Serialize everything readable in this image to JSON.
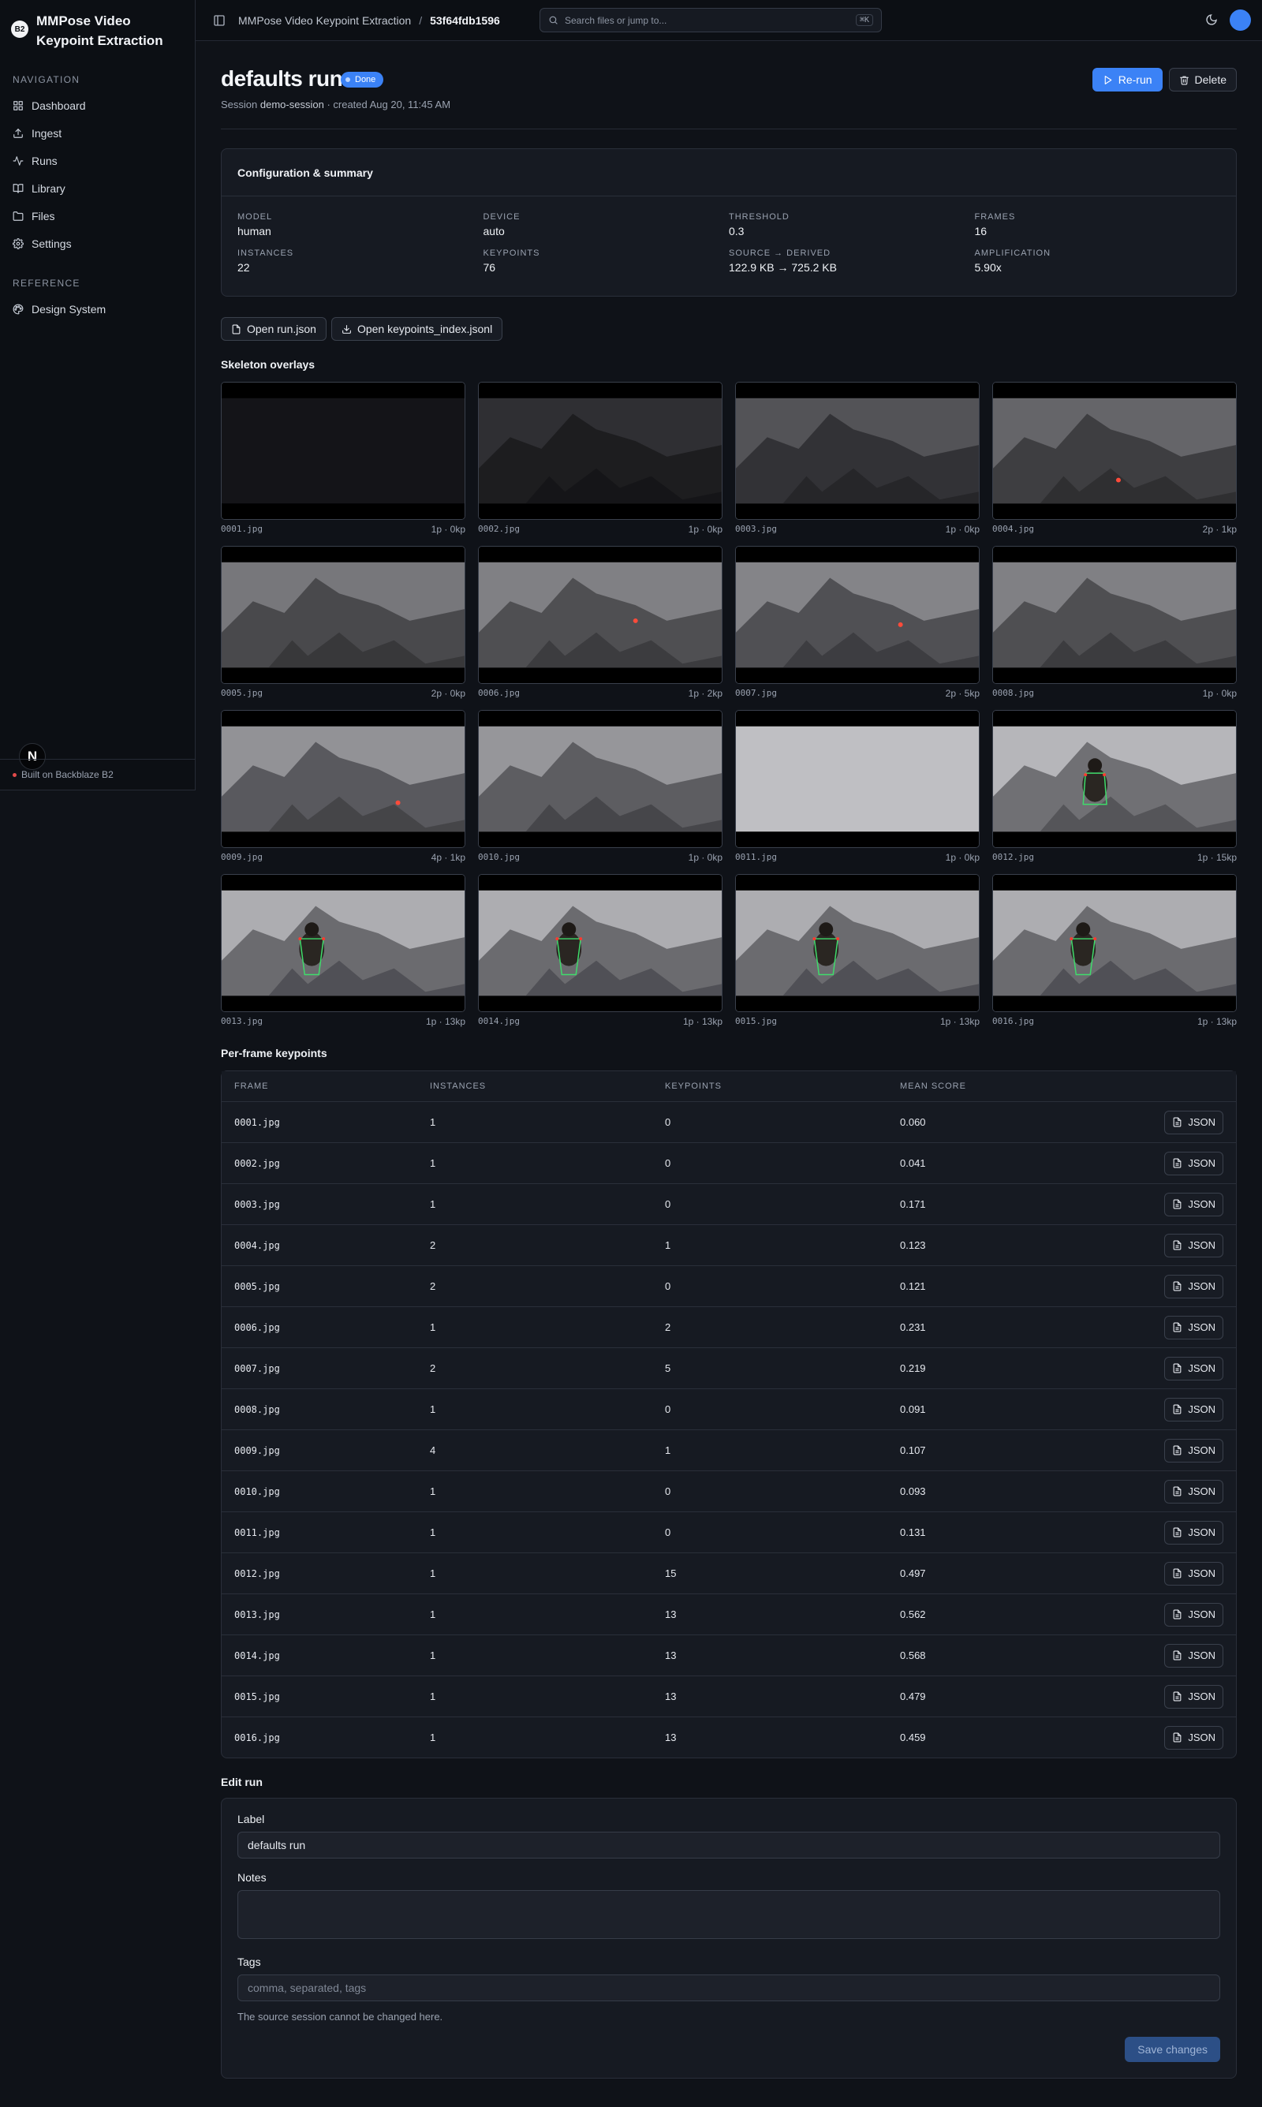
{
  "app": {
    "logo": "B2",
    "title": "MMPose Video Keypoint Extraction"
  },
  "sidebar": {
    "nav_heading": "NAVIGATION",
    "nav": [
      {
        "label": "Dashboard",
        "icon": "grid-icon"
      },
      {
        "label": "Ingest",
        "icon": "upload-icon"
      },
      {
        "label": "Runs",
        "icon": "activity-icon"
      },
      {
        "label": "Library",
        "icon": "book-icon"
      },
      {
        "label": "Files",
        "icon": "folder-icon"
      },
      {
        "label": "Settings",
        "icon": "gear-icon"
      }
    ],
    "ref_heading": "REFERENCE",
    "ref": [
      {
        "label": "Design System",
        "icon": "palette-icon"
      }
    ],
    "footer": "Built on Backblaze B2",
    "badge": "N"
  },
  "topbar": {
    "crumb_app": "MMPose Video Keypoint Extraction",
    "crumb_sep": "/",
    "crumb_run": "53f64fdb1596",
    "search_placeholder": "Search files or jump to...",
    "search_kbd": "⌘K"
  },
  "header": {
    "title": "defaults run",
    "status": "Done",
    "session_prefix": "Session",
    "session": "demo-session",
    "created": "· created Aug 20, 11:45 AM",
    "rerun": "Re-run",
    "delete": "Delete"
  },
  "summary": {
    "title": "Configuration & summary",
    "items": [
      {
        "label": "MODEL",
        "value": "human"
      },
      {
        "label": "DEVICE",
        "value": "auto"
      },
      {
        "label": "THRESHOLD",
        "value": "0.3"
      },
      {
        "label": "FRAMES",
        "value": "16"
      },
      {
        "label": "INSTANCES",
        "value": "22"
      },
      {
        "label": "KEYPOINTS",
        "value": "76"
      },
      {
        "label": "SOURCE → DERIVED",
        "value": "122.9 KB → 725.2 KB"
      },
      {
        "label": "AMPLIFICATION",
        "value": "5.90x"
      }
    ]
  },
  "files": {
    "open_run": "Open run.json",
    "open_index": "Open keypoints_index.jsonl"
  },
  "overlays": {
    "title": "Skeleton overlays",
    "frames": [
      {
        "name": "0001.jpg",
        "stats": "1p · 0kp"
      },
      {
        "name": "0002.jpg",
        "stats": "1p · 0kp"
      },
      {
        "name": "0003.jpg",
        "stats": "1p · 0kp"
      },
      {
        "name": "0004.jpg",
        "stats": "2p · 1kp"
      },
      {
        "name": "0005.jpg",
        "stats": "2p · 0kp"
      },
      {
        "name": "0006.jpg",
        "stats": "1p · 2kp"
      },
      {
        "name": "0007.jpg",
        "stats": "2p · 5kp"
      },
      {
        "name": "0008.jpg",
        "stats": "1p · 0kp"
      },
      {
        "name": "0009.jpg",
        "stats": "4p · 1kp"
      },
      {
        "name": "0010.jpg",
        "stats": "1p · 0kp"
      },
      {
        "name": "0011.jpg",
        "stats": "1p · 0kp"
      },
      {
        "name": "0012.jpg",
        "stats": "1p · 15kp"
      },
      {
        "name": "0013.jpg",
        "stats": "1p · 13kp"
      },
      {
        "name": "0014.jpg",
        "stats": "1p · 13kp"
      },
      {
        "name": "0015.jpg",
        "stats": "1p · 13kp"
      },
      {
        "name": "0016.jpg",
        "stats": "1p · 13kp"
      }
    ]
  },
  "keypoints": {
    "title": "Per-frame keypoints",
    "columns": [
      "FRAME",
      "INSTANCES",
      "KEYPOINTS",
      "MEAN SCORE"
    ],
    "json_label": "JSON",
    "rows": [
      {
        "frame": "0001.jpg",
        "instances": "1",
        "keypoints": "0",
        "score": "0.060"
      },
      {
        "frame": "0002.jpg",
        "instances": "1",
        "keypoints": "0",
        "score": "0.041"
      },
      {
        "frame": "0003.jpg",
        "instances": "1",
        "keypoints": "0",
        "score": "0.171"
      },
      {
        "frame": "0004.jpg",
        "instances": "2",
        "keypoints": "1",
        "score": "0.123"
      },
      {
        "frame": "0005.jpg",
        "instances": "2",
        "keypoints": "0",
        "score": "0.121"
      },
      {
        "frame": "0006.jpg",
        "instances": "1",
        "keypoints": "2",
        "score": "0.231"
      },
      {
        "frame": "0007.jpg",
        "instances": "2",
        "keypoints": "5",
        "score": "0.219"
      },
      {
        "frame": "0008.jpg",
        "instances": "1",
        "keypoints": "0",
        "score": "0.091"
      },
      {
        "frame": "0009.jpg",
        "instances": "4",
        "keypoints": "1",
        "score": "0.107"
      },
      {
        "frame": "0010.jpg",
        "instances": "1",
        "keypoints": "0",
        "score": "0.093"
      },
      {
        "frame": "0011.jpg",
        "instances": "1",
        "keypoints": "0",
        "score": "0.131"
      },
      {
        "frame": "0012.jpg",
        "instances": "1",
        "keypoints": "15",
        "score": "0.497"
      },
      {
        "frame": "0013.jpg",
        "instances": "1",
        "keypoints": "13",
        "score": "0.562"
      },
      {
        "frame": "0014.jpg",
        "instances": "1",
        "keypoints": "13",
        "score": "0.568"
      },
      {
        "frame": "0015.jpg",
        "instances": "1",
        "keypoints": "13",
        "score": "0.479"
      },
      {
        "frame": "0016.jpg",
        "instances": "1",
        "keypoints": "13",
        "score": "0.459"
      }
    ]
  },
  "edit": {
    "title": "Edit run",
    "label_label": "Label",
    "label_value": "defaults run",
    "notes_label": "Notes",
    "notes_value": "",
    "tags_label": "Tags",
    "tags_placeholder": "comma, separated, tags",
    "hint": "The source session cannot be changed here.",
    "save": "Save changes"
  },
  "colors": {
    "accent": "#3b82f6",
    "background": "#0f1218",
    "card": "#161a22"
  }
}
